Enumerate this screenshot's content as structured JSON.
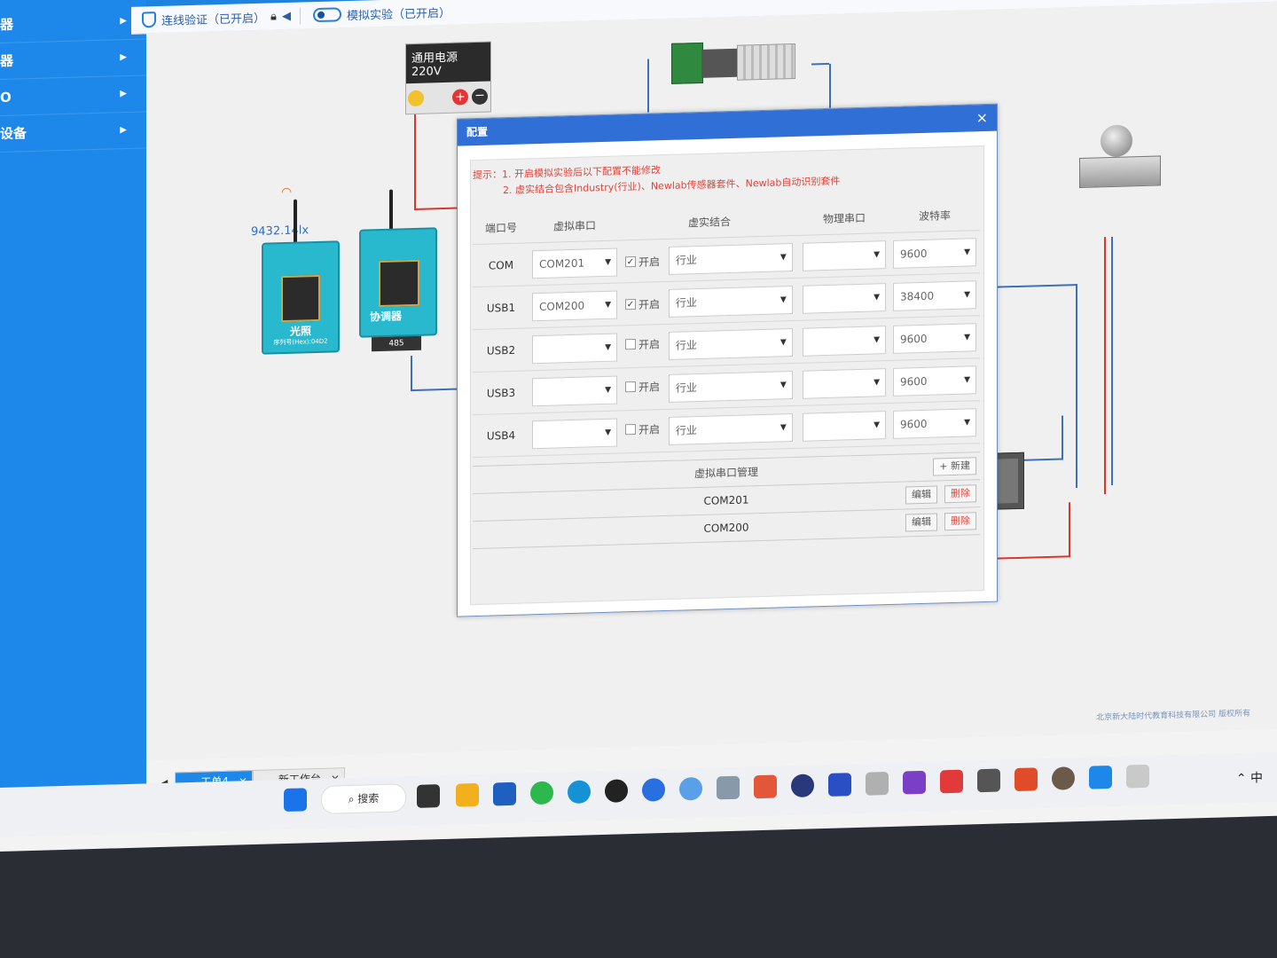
{
  "sidebar": {
    "items": [
      {
        "label": "器"
      },
      {
        "label": "器"
      },
      {
        "label": "O"
      },
      {
        "label": "设备"
      }
    ]
  },
  "toolbar": {
    "verify_label": "连线验证（已开启）",
    "sim_label": "模拟实验（已开启）"
  },
  "canvas": {
    "power_title": "通用电源220V",
    "sensor_reading": "9432.14lx",
    "device1_name": "光照",
    "device1_serial": "序列号(Hex):04D2",
    "device2_name": "协调器",
    "device2_port": "485"
  },
  "dialog": {
    "title": "配置",
    "close": "×",
    "tip_line1": "提示：1. 开启模拟实验后以下配置不能修改",
    "tip_line2": "2. 虚实结合包含Industry(行业)、Newlab传感器套件、Newlab自动识别套件",
    "columns": [
      "端口号",
      "虚拟串口",
      "虚实结合",
      "物理串口",
      "波特率"
    ],
    "enable_label": "开启",
    "rows": [
      {
        "port": "COM",
        "vport": "COM201",
        "checked": "✓",
        "mode": "行业",
        "phys": "",
        "baud": "9600"
      },
      {
        "port": "USB1",
        "vport": "COM200",
        "checked": "✓",
        "mode": "行业",
        "phys": "",
        "baud": "38400"
      },
      {
        "port": "USB2",
        "vport": "",
        "checked": "",
        "mode": "行业",
        "phys": "",
        "baud": "9600"
      },
      {
        "port": "USB3",
        "vport": "",
        "checked": "",
        "mode": "行业",
        "phys": "",
        "baud": "9600"
      },
      {
        "port": "USB4",
        "vport": "",
        "checked": "",
        "mode": "行业",
        "phys": "",
        "baud": "9600"
      }
    ],
    "vmgr": {
      "title": "虚拟串口管理",
      "new_label": "+ 新建",
      "edit_label": "编辑",
      "delete_label": "删除",
      "items": [
        "COM201",
        "COM200"
      ]
    }
  },
  "tabs": [
    {
      "label": "工单4"
    },
    {
      "label": "新工作台"
    }
  ],
  "copyright": "北京新大陆时代教育科技有限公司 版权所有",
  "taskbar": {
    "search_label": "搜索",
    "ime": "中"
  },
  "colors": {
    "accent": "#1e88ea",
    "dialog_title": "#2f6fd6",
    "tip": "#e0443a",
    "device": "#29b9cf"
  }
}
